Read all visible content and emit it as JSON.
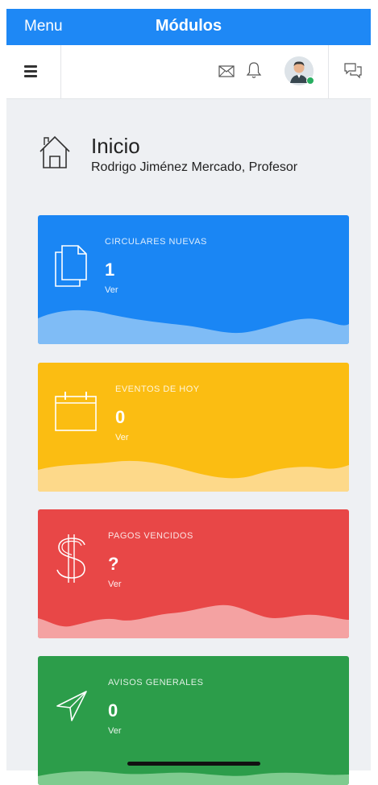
{
  "topbar": {
    "menu": "Menu",
    "title": "Módulos"
  },
  "header": {
    "title": "Inicio",
    "subtitle": "Rodrigo Jiménez Mercado, Profesor"
  },
  "cards": [
    {
      "label": "CIRCULARES NUEVAS",
      "count": "1",
      "link": "Ver",
      "color": "#1a86f4",
      "wave": "#7fbcf6",
      "icon": "documents-icon"
    },
    {
      "label": "EVENTOS DE HOY",
      "count": "0",
      "link": "Ver",
      "color": "#fbbd12",
      "wave": "#fdd98a",
      "icon": "calendar-icon"
    },
    {
      "label": "PAGOS VENCIDOS",
      "count": "?",
      "link": "Ver",
      "color": "#e84747",
      "wave": "#f4a2a2",
      "icon": "dollar-icon"
    },
    {
      "label": "AVISOS GENERALES",
      "count": "0",
      "link": "Ver",
      "color": "#2c9d4a",
      "wave": "#7fcb8f",
      "icon": "send-icon"
    }
  ],
  "colors": {
    "topbar": "#1e88f5",
    "background": "#eef0f3"
  }
}
